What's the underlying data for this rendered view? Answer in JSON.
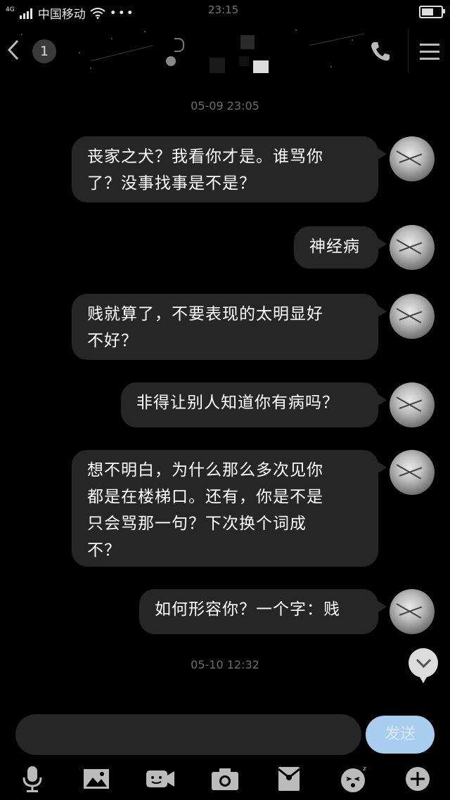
{
  "status_bar": {
    "network_type": "4G",
    "carrier": "中国移动",
    "more": "•••",
    "time": "23:15",
    "battery_level": 0.6
  },
  "header": {
    "unread_count": "1",
    "icons": [
      "back-chevron-icon",
      "phone-icon",
      "menu-icon"
    ]
  },
  "messages": [
    {
      "type": "timestamp",
      "text": "05-09 23:05"
    },
    {
      "type": "sent",
      "lines": [
        "丧家之犬？我看你才是。谁骂你",
        "了？没事找事是不是？"
      ]
    },
    {
      "type": "sent",
      "lines": [
        "神经病"
      ]
    },
    {
      "type": "sent",
      "lines": [
        "贱就算了，不要表现的太明显好",
        "不好？"
      ]
    },
    {
      "type": "sent",
      "lines": [
        "非得让别人知道你有病吗？"
      ]
    },
    {
      "type": "sent",
      "lines": [
        "想不明白，为什么那么多次见你",
        "都是在楼梯口。还有，你是不是",
        "只会骂那一句？下次换个词成",
        "不？"
      ]
    },
    {
      "type": "sent",
      "lines": [
        "如何形容你？一个字：贱"
      ]
    },
    {
      "type": "timestamp",
      "text": "05-10 12:32"
    }
  ],
  "composer": {
    "input_value": "",
    "send_label": "发送"
  },
  "toolbar": {
    "icons": [
      "microphone-icon",
      "image-icon",
      "video-call-icon",
      "camera-icon",
      "red-packet-icon",
      "emoji-icon",
      "plus-icon"
    ]
  },
  "colors": {
    "background": "#000000",
    "bubble": "#262626",
    "send_button": "#a8cdee",
    "timestamp": "#6d6d6d"
  }
}
